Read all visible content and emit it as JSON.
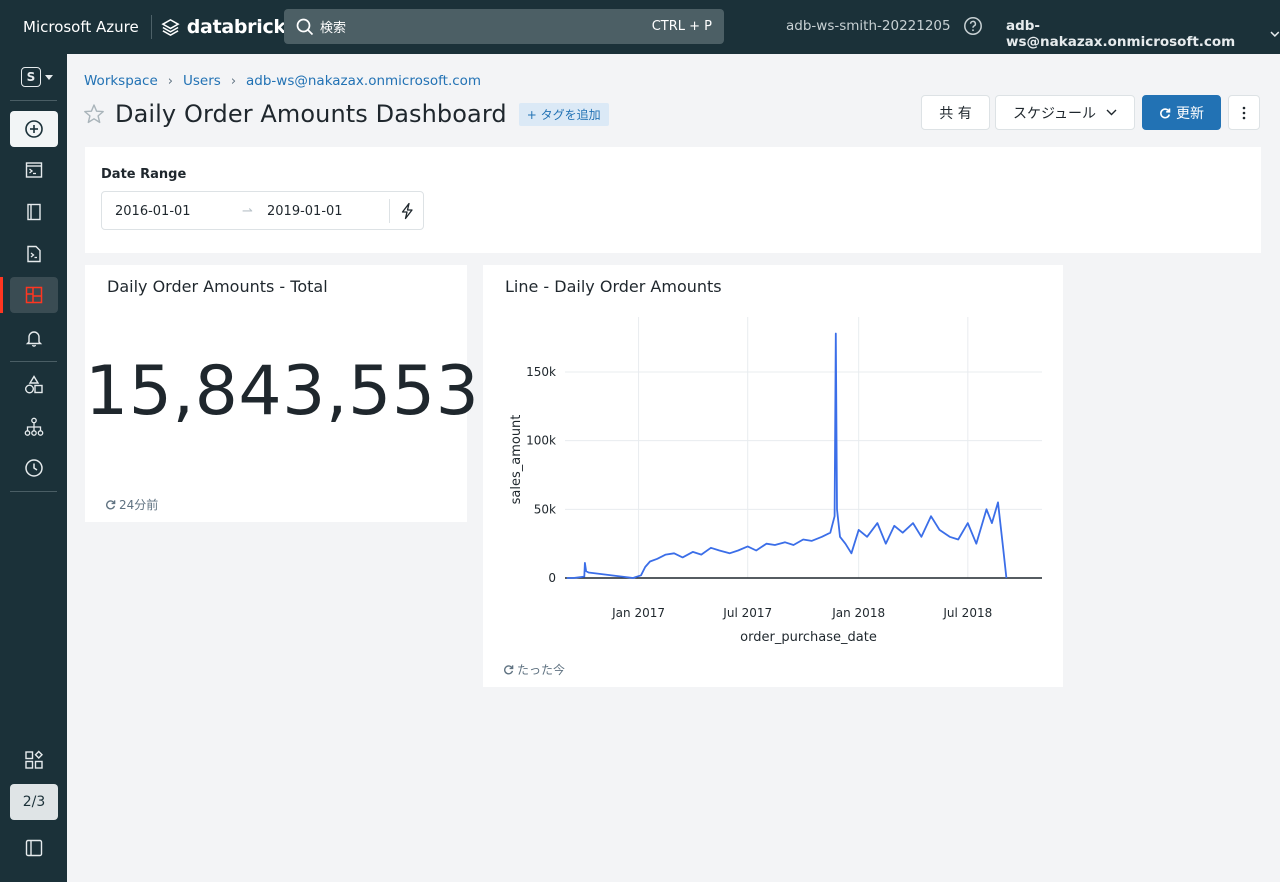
{
  "header": {
    "brand_azure": "Microsoft Azure",
    "brand_databricks": "databricks",
    "search_placeholder": "検索",
    "search_shortcut": "CTRL + P",
    "workspace_name": "adb-ws-smith-20221205",
    "user_email": "adb-ws@nakazax.onmicrosoft.com"
  },
  "sidebar": {
    "persona_letter": "S",
    "page_indicator": "2/3",
    "items": [
      {
        "name": "create",
        "icon": "plus-circle-icon"
      },
      {
        "name": "sql-editor",
        "icon": "terminal-icon"
      },
      {
        "name": "queries",
        "icon": "book-icon"
      },
      {
        "name": "query-file",
        "icon": "file-code-icon"
      },
      {
        "name": "dashboards",
        "icon": "dashboard-icon",
        "active": true
      },
      {
        "name": "alerts",
        "icon": "bell-icon"
      },
      {
        "name": "data",
        "icon": "shapes-icon"
      },
      {
        "name": "workflows",
        "icon": "hierarchy-icon"
      },
      {
        "name": "history",
        "icon": "clock-icon"
      },
      {
        "name": "partner-connect",
        "icon": "apps-icon"
      },
      {
        "name": "collapse",
        "icon": "sidebar-collapse-icon"
      }
    ]
  },
  "breadcrumb": [
    "Workspace",
    "Users",
    "adb-ws@nakazax.onmicrosoft.com"
  ],
  "dashboard": {
    "title": "Daily Order Amounts Dashboard",
    "add_tag": "+ タグを追加",
    "share_label": "共 有",
    "schedule_label": "スケジュール",
    "refresh_label": "更新"
  },
  "filter": {
    "label": "Date Range",
    "from": "2016-01-01",
    "to": "2019-01-01"
  },
  "widgets": {
    "total": {
      "title": "Daily Order Amounts - Total",
      "value": "15,843,553",
      "refreshed": "24分前"
    },
    "line": {
      "title": "Line - Daily Order Amounts",
      "refreshed": "たった今"
    }
  },
  "colors": {
    "topbar": "#1b3139",
    "accent": "#2272b4",
    "active_marker": "#ff3621",
    "line": "#3b6ee8"
  },
  "chart_data": {
    "type": "line",
    "title": "Line - Daily Order Amounts",
    "xlabel": "order_purchase_date",
    "ylabel": "sales_amount",
    "x_ticks": [
      "Jan 2017",
      "Jul 2017",
      "Jan 2018",
      "Jul 2018"
    ],
    "y_ticks": [
      "0",
      "50k",
      "100k",
      "150k"
    ],
    "xlim": [
      "2016-09-01",
      "2018-11-01"
    ],
    "ylim": [
      0,
      190000
    ],
    "grid": true,
    "series": [
      {
        "color": "#3b6ee8",
        "x": [
          "2016-09-04",
          "2016-09-15",
          "2016-10-03",
          "2016-10-04",
          "2016-10-06",
          "2016-10-10",
          "2016-12-23",
          "2017-01-05",
          "2017-01-12",
          "2017-01-20",
          "2017-02-01",
          "2017-02-15",
          "2017-03-01",
          "2017-03-15",
          "2017-04-01",
          "2017-04-15",
          "2017-05-01",
          "2017-05-15",
          "2017-06-01",
          "2017-06-15",
          "2017-07-01",
          "2017-07-15",
          "2017-08-01",
          "2017-08-15",
          "2017-09-01",
          "2017-09-15",
          "2017-10-01",
          "2017-10-15",
          "2017-11-01",
          "2017-11-15",
          "2017-11-22",
          "2017-11-24",
          "2017-11-26",
          "2017-12-01",
          "2017-12-10",
          "2017-12-20",
          "2018-01-01",
          "2018-01-15",
          "2018-02-01",
          "2018-02-15",
          "2018-03-01",
          "2018-03-15",
          "2018-04-01",
          "2018-04-15",
          "2018-05-01",
          "2018-05-15",
          "2018-06-01",
          "2018-06-15",
          "2018-07-01",
          "2018-07-15",
          "2018-08-01",
          "2018-08-10",
          "2018-08-20",
          "2018-08-29",
          "2018-09-03"
        ],
        "y": [
          0,
          0,
          1000,
          11000,
          5000,
          4000,
          0,
          2000,
          8000,
          12000,
          14000,
          17000,
          18000,
          15000,
          19000,
          17000,
          22000,
          20000,
          18000,
          20000,
          23000,
          20000,
          25000,
          24000,
          26000,
          24000,
          28000,
          27000,
          30000,
          33000,
          45000,
          178000,
          50000,
          30000,
          25000,
          18000,
          35000,
          30000,
          40000,
          25000,
          38000,
          33000,
          40000,
          30000,
          45000,
          35000,
          30000,
          28000,
          40000,
          25000,
          50000,
          40000,
          55000,
          20000,
          0
        ]
      }
    ]
  }
}
